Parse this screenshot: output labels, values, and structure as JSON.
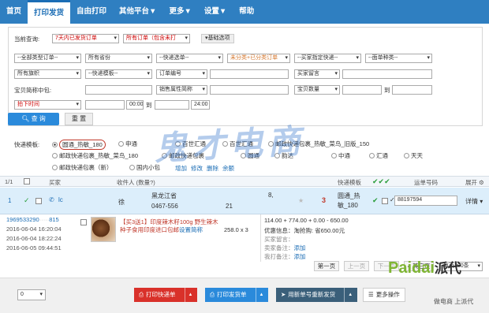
{
  "nav": {
    "items": [
      {
        "label": "首页"
      },
      {
        "label": "打印发货",
        "active": true
      },
      {
        "label": "自由打印"
      },
      {
        "label": "其他平台▼"
      },
      {
        "label": "更多▼"
      },
      {
        "label": "设置▼"
      },
      {
        "label": "帮助"
      }
    ],
    "bg_color": "#2f7fc1"
  },
  "filters": {
    "query_label": "当前查询:",
    "date_range": "7天内已发货订单",
    "order_type": "所有订单（包含未打",
    "adv_btn": "基础选项",
    "row2": [
      "--全部类型订单--",
      "所有省份",
      "--快递选单--",
      "未分类+已分类订单",
      "--买家指定快递--",
      "--面单种类--"
    ],
    "row3": [
      "所有旗帜",
      "--快递模板--",
      "订单编号",
      "买家留言"
    ],
    "row4_label1": "宝贝简称中包:",
    "row4_sel": "销售属性简称",
    "row4_label2": "宝贝数量",
    "to_label": "到",
    "row5_sel": "拍下时间",
    "time_start": "00:00",
    "time_to": "到",
    "time_end": "24:00",
    "search_btn": "查 询",
    "reset_btn": "重 置"
  },
  "templates": {
    "label": "快递模板:",
    "options": [
      "圆通_热敏_180",
      "申通",
      "百世汇通",
      "百世汇通",
      "邮政快递包裹_热敏_菜鸟_旧版_150",
      "邮政快递包裹_热敏_菜鸟_180",
      "邮政快递包裹",
      "圆通",
      "韵达",
      "中通",
      "汇通",
      "天天",
      "邮政快递包裹（新）",
      "国内小包"
    ],
    "links": [
      "增加",
      "修改",
      "删除",
      "余额"
    ]
  },
  "list_header": {
    "page": "1/1",
    "buyer": "买家",
    "receiver": "收件人 (数量?)",
    "express_tpl": "快递模板",
    "waybill": "运单号码",
    "expand": "展开"
  },
  "order": {
    "buyer_short": "lc",
    "receiver_name": "徐",
    "address": "黑龙江省",
    "phone": "0467-556",
    "phone_tail": "21",
    "region_tail": "8,",
    "qty": "3",
    "tpl": "圆通_热敏_180",
    "waybill": "88197594",
    "detail_btn": "详情",
    "order_no": "1969533290",
    "order_no_tail": "815",
    "time_pay": "2016-06-04 16:20:04",
    "time_print": "2016-06-04 18:22:24",
    "time_ship": "2016-06-05 09:44:51",
    "product": "【买3送1】印度辣木籽100g 野生辣木种子食用印度进口包邮",
    "product_link": "设置简称",
    "price_qty": "258.0 x 3",
    "calc": "114.00 + 774.00 + 0.00 - 650.00",
    "discount": "优惠信息：淘抢购: 省650.00元",
    "buyer_msg": "买家留言：",
    "seller_note": "卖家备注：",
    "seller_note_link": "添加",
    "print_note": "我打备注：",
    "print_note_link": "添加"
  },
  "pager": {
    "first": "第一页",
    "prev": "上一页",
    "next": "下一页",
    "other": "« 其它页",
    "per_page": "每页200条"
  },
  "bottom": {
    "count": "0",
    "btn_print_express": "打印快递单",
    "btn_print_ship": "打印发货单",
    "btn_reship": "用新单号重新发货",
    "btn_more": "更多操作"
  },
  "watermark": "鬼才电商",
  "logo": {
    "brand": "Paidai",
    "brand_cn": "派代",
    "sub": "做电商  上派代"
  },
  "colors": {
    "nav": "#2f7fc1",
    "red_btn": "#d9312a",
    "blue_btn": "#2a8adb",
    "teal_btn": "#3a5f7a",
    "row_highlight": "#dceefb"
  }
}
